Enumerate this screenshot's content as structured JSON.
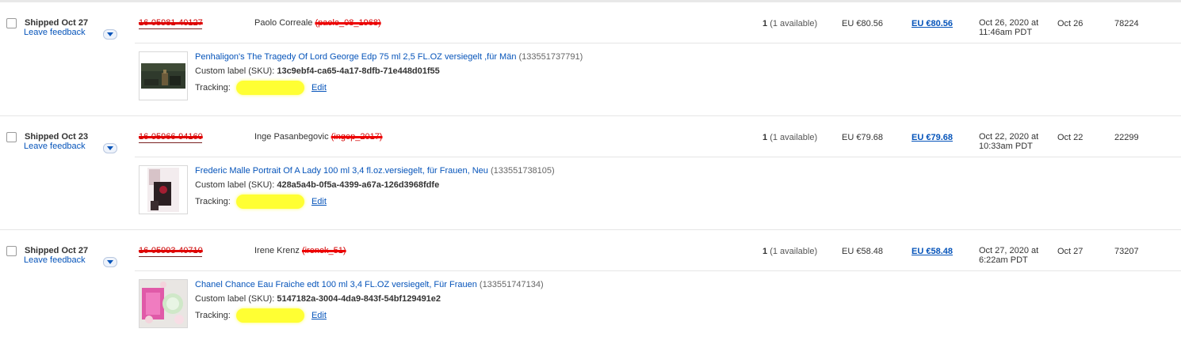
{
  "orders": [
    {
      "status": "Shipped Oct 27",
      "feedback_label": "Leave feedback",
      "order_number": "16-05981-40127",
      "buyer_name": "Paolo Correale",
      "buyer_user": "(paolo_08_1968)",
      "quantity": "1",
      "available": "(1 available)",
      "price": "EU €80.56",
      "total": "EU €80.56",
      "date_line1": "Oct 26, 2020 at",
      "date_line2": "11:46am PDT",
      "paid_date": "Oct 26",
      "postal_code": "78224",
      "item_title": "Penhaligon's The Tragedy Of Lord George Edp 75 ml 2,5 FL.OZ versiegelt ,für Män",
      "item_id": "(133551737791)",
      "sku_label": "Custom label (SKU):",
      "sku": "13c9ebf4-ca65-4a17-8dfb-71e448d01f55",
      "tracking_label": "Tracking:",
      "edit_label": "Edit"
    },
    {
      "status": "Shipped Oct 23",
      "feedback_label": "Leave feedback",
      "order_number": "16-05966-94160",
      "buyer_name": "Inge Pasanbegovic",
      "buyer_user": "(ingep_2017)",
      "quantity": "1",
      "available": "(1 available)",
      "price": "EU €79.68",
      "total": "EU €79.68",
      "date_line1": "Oct 22, 2020 at",
      "date_line2": "10:33am PDT",
      "paid_date": "Oct 22",
      "postal_code": "22299",
      "item_title": "Frederic Malle Portrait Of A Lady 100 ml 3,4 fl.oz.versiegelt, für Frauen, Neu",
      "item_id": "(133551738105)",
      "sku_label": "Custom label (SKU):",
      "sku": "428a5a4b-0f5a-4399-a67a-126d3968fdfe",
      "tracking_label": "Tracking:",
      "edit_label": "Edit"
    },
    {
      "status": "Shipped Oct 27",
      "feedback_label": "Leave feedback",
      "order_number": "16-05993-40710",
      "buyer_name": "Irene Krenz",
      "buyer_user": "(irenek_51)",
      "quantity": "1",
      "available": "(1 available)",
      "price": "EU €58.48",
      "total": "EU €58.48",
      "date_line1": "Oct 27, 2020 at",
      "date_line2": "6:22am PDT",
      "paid_date": "Oct 27",
      "postal_code": "73207",
      "item_title": "Chanel Chance Eau Fraiche edt 100 ml 3,4 FL.OZ versiegelt, Für Frauen",
      "item_id": "(133551747134)",
      "sku_label": "Custom label (SKU):",
      "sku": "5147182a-3004-4da9-843f-54bf129491e2",
      "tracking_label": "Tracking:",
      "edit_label": "Edit"
    }
  ],
  "colors": {
    "link": "#0654ba",
    "redaction": "#e00000",
    "highlight": "#ffff33"
  }
}
